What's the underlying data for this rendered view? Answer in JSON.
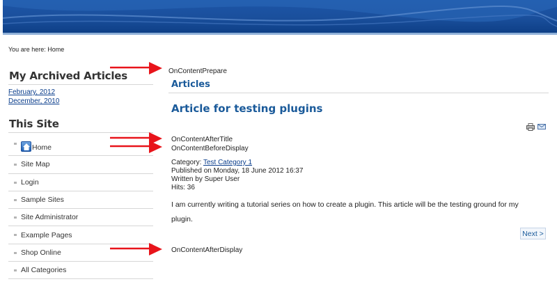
{
  "breadcrumb": {
    "prefix": "You are here:",
    "current": "Home"
  },
  "archive": {
    "title": "My Archived Articles",
    "links": [
      "February, 2012",
      "December, 2010"
    ]
  },
  "site": {
    "title": "This Site",
    "items": [
      "Home",
      "Site Map",
      "Login",
      "Sample Sites",
      "Site Administrator",
      "Example Pages",
      "Shop Online",
      "All Categories"
    ]
  },
  "events": {
    "prepare": "OnContentPrepare",
    "after_title": "OnContentAfterTitle",
    "before_display": "OnContentBeforeDisplay",
    "after_display": "OnContentAfterDisplay"
  },
  "main": {
    "section_title": "Articles",
    "article_title": "Article for testing plugins",
    "category_label": "Category:",
    "category_value": "Test Category 1",
    "published": "Published on Monday, 18 June 2012 16:37",
    "written_by": "Written by Super User",
    "hits": "Hits: 36",
    "body": "I am currently writing a tutorial series on how to create a plugin. This article will be the testing ground for my plugin.",
    "next": "Next >"
  },
  "icons": {
    "print": "print-icon",
    "email": "email-icon",
    "home": "home-icon",
    "arrow": "red-arrow-icon"
  },
  "colors": {
    "header": "#1a4f9c",
    "heading": "#1a5a9a",
    "arrow": "#e8141b",
    "link": "#0b3e8c"
  }
}
